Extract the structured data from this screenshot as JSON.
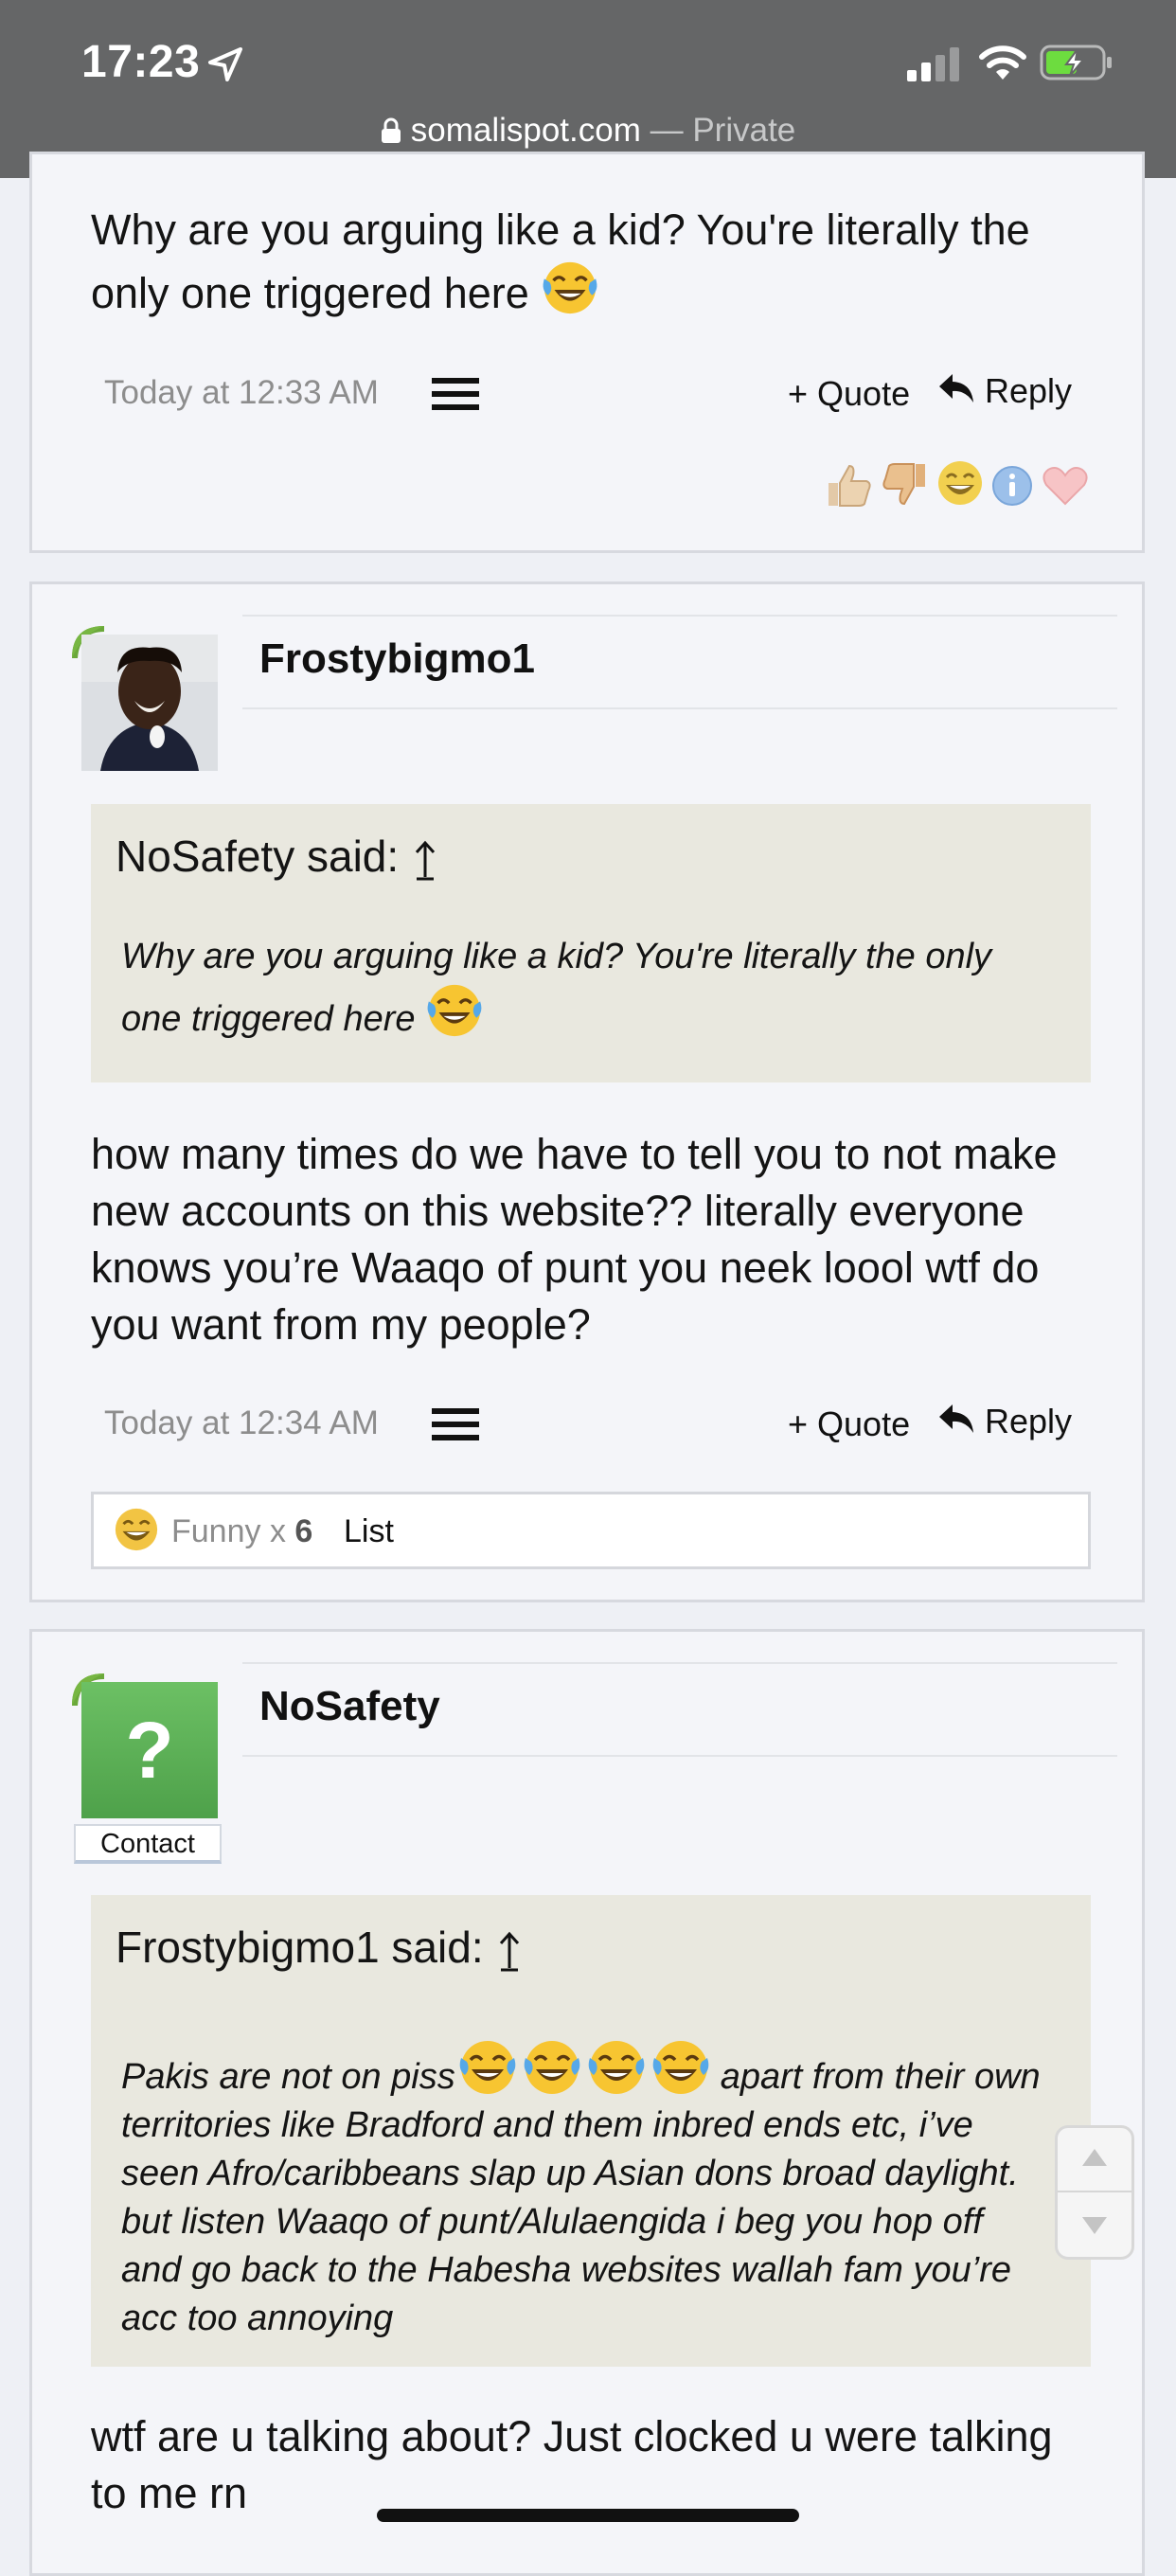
{
  "status_bar": {
    "time": "17:23",
    "url_domain": "somalispot.com",
    "url_suffix": " — Private"
  },
  "post_top": {
    "message_line1": "Why are you arguing like a kid? You're literally the",
    "message_line2": "only one triggered here",
    "timestamp": "Today at 12:33 AM",
    "quote_label": "+ Quote",
    "reply_label": "Reply",
    "reaction_icons": [
      "thumbs-up-icon",
      "thumbs-down-icon",
      "funny-icon",
      "info-icon",
      "heart-icon"
    ]
  },
  "post_frosty": {
    "username": "Frostybigmo1",
    "quote_header": "NoSafety said:",
    "quote_line1": "Why are you arguing like a kid? You're literally the only",
    "quote_line2": "one triggered here",
    "message_lines": [
      "how many times do we have to tell you to not make",
      "new accounts on this website?? literally everyone",
      "knows you’re Waaqo of punt you neek loool wtf do",
      "you want from my people?"
    ],
    "timestamp": "Today at 12:34 AM",
    "quote_label": "+ Quote",
    "reply_label": "Reply",
    "reaction_summary": {
      "label": "Funny",
      "times": "x",
      "count": "6",
      "list_label": "List"
    }
  },
  "post_nosafety": {
    "username": "NoSafety",
    "avatar_glyph": "?",
    "contact_label": "Contact",
    "quote_header": "Frostybigmo1 said:",
    "quote_line1_a": "Pakis are not on piss",
    "quote_line1_b": "apart from their own",
    "quote_lines": [
      "territories like Bradford and them inbred ends etc, i’ve",
      "seen Afro/caribbeans slap up Asian dons broad daylight.",
      "but listen Waaqo of punt/Alulaengida i beg you hop off",
      "and go back to the Habesha websites wallah fam you’re",
      "acc too annoying"
    ],
    "message_lines": [
      "wtf are u talking about? Just clocked u were talking",
      "to me rn"
    ]
  },
  "colors": {
    "status_bar_bg": "#656667",
    "page_bg": "#eef0f5",
    "post_bg": "#f4f5f9",
    "quote_bg": "#e9e8df",
    "avatar_green": "#5fb55a",
    "battery_green": "#6ddc3f"
  }
}
